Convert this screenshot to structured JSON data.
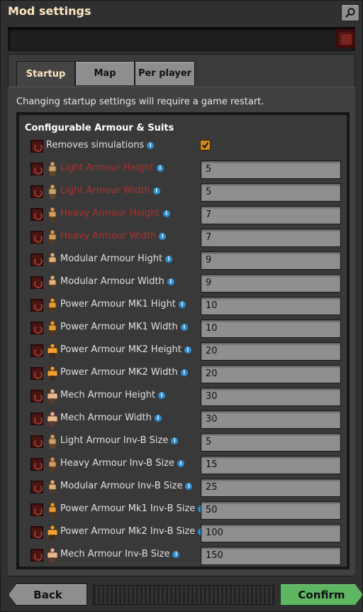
{
  "window": {
    "title": "Mod settings"
  },
  "tabs": [
    {
      "label": "Startup",
      "active": true
    },
    {
      "label": "Map",
      "active": false
    },
    {
      "label": "Per player",
      "active": false
    }
  ],
  "notice": "Changing startup settings will require a game restart.",
  "section": {
    "title": "Configurable Armour & Suits"
  },
  "settings": [
    {
      "label": "Removes simulations",
      "type": "checkbox",
      "checked": true,
      "red": false,
      "icon": "none"
    },
    {
      "label": "Light Armour Height",
      "value": "5",
      "red": true,
      "icon": "light-armour-icon"
    },
    {
      "label": "Light Armour Width",
      "value": "5",
      "red": true,
      "icon": "light-armour-icon"
    },
    {
      "label": "Heavy Armour Height",
      "value": "7",
      "red": true,
      "icon": "heavy-armour-icon"
    },
    {
      "label": "Heavy Armour Width",
      "value": "7",
      "red": true,
      "icon": "heavy-armour-icon"
    },
    {
      "label": "Modular Armour Hight",
      "value": "9",
      "red": false,
      "icon": "modular-armour-icon"
    },
    {
      "label": "Modular Armour Width",
      "value": "9",
      "red": false,
      "icon": "modular-armour-icon"
    },
    {
      "label": "Power Armour MK1 Hight",
      "value": "10",
      "red": false,
      "icon": "power-armour-mk1-icon"
    },
    {
      "label": "Power Armour MK1 Width",
      "value": "10",
      "red": false,
      "icon": "power-armour-mk1-icon"
    },
    {
      "label": "Power Armour MK2 Height",
      "value": "20",
      "red": false,
      "icon": "power-armour-mk2-icon"
    },
    {
      "label": "Power Armour MK2 Width",
      "value": "20",
      "red": false,
      "icon": "power-armour-mk2-icon"
    },
    {
      "label": "Mech Armour Height",
      "value": "30",
      "red": false,
      "icon": "mech-armour-icon"
    },
    {
      "label": "Mech Armour Width",
      "value": "30",
      "red": false,
      "icon": "mech-armour-icon"
    },
    {
      "label": "Light Armour Inv-B Size",
      "value": "5",
      "red": false,
      "icon": "light-armour-icon"
    },
    {
      "label": "Heavy Armour Inv-B Size",
      "value": "15",
      "red": false,
      "icon": "heavy-armour-icon"
    },
    {
      "label": "Modular Armour Inv-B Size",
      "value": "25",
      "red": false,
      "icon": "modular-armour-icon"
    },
    {
      "label": "Power Armour Mk1 Inv-B Size",
      "value": "50",
      "red": false,
      "icon": "power-armour-mk1-icon"
    },
    {
      "label": "Power Armour Mk2 Inv-B Size",
      "value": "100",
      "red": false,
      "icon": "power-armour-mk2-icon"
    },
    {
      "label": "Mech Armour Inv-B Size",
      "value": "150",
      "red": false,
      "icon": "mech-armour-icon"
    }
  ],
  "footer": {
    "back_label": "Back",
    "confirm_label": "Confirm"
  },
  "colors": {
    "title": "#ffe6c0",
    "red_label": "#b0302a",
    "confirm": "#5eb662",
    "checkbox": "#d08a1a",
    "info": "#2e8ed0"
  }
}
